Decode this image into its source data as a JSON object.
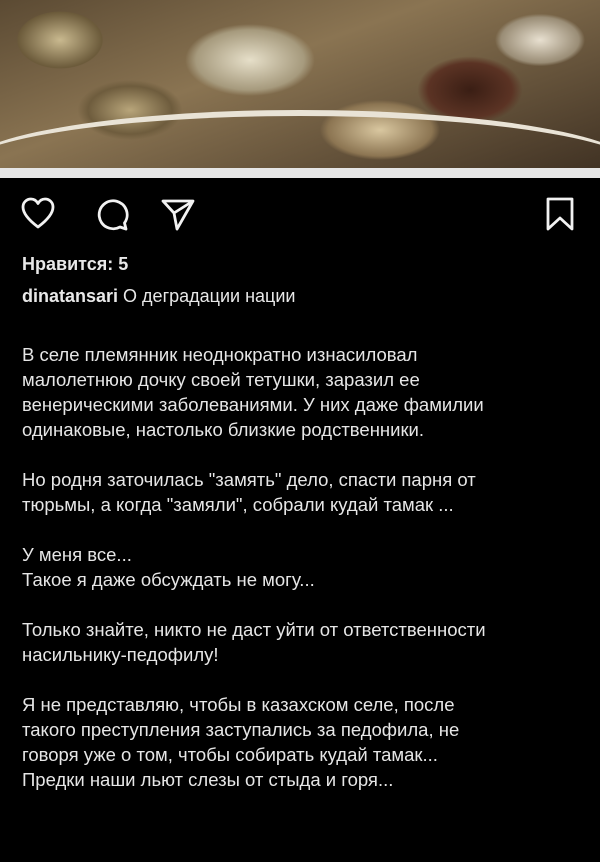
{
  "post": {
    "likes_text": "Нравится: 5",
    "username": "dinatansari",
    "caption": "О деградации нации",
    "paragraphs": [
      [
        "В селе племянник  неоднократно изнасиловал",
        "малолетнюю дочку своей тетушки, заразил ее",
        "венерическими заболеваниями. У них даже фамилии",
        "одинаковые, настолько близкие родственники."
      ],
      [
        "Но родня заточилась \"замять\" дело, спасти парня от",
        "тюрьмы, а когда \"замяли\", собрали кудай тамак ..."
      ],
      [
        "У меня все...",
        "Такое я даже обсуждать не могу..."
      ],
      [
        "Только знайте,  никто не даст уйти от ответственности",
        "насильнику-педофилу!"
      ],
      [
        "Я не представляю, чтобы в казахском селе, после",
        "такого преступления заступались за педофила, не",
        "говоря уже о том, чтобы собирать кудай тамак...",
        "Предки наши льют слезы от стыда и горя..."
      ]
    ]
  },
  "icons": {
    "like": "heart-icon",
    "comment": "comment-icon",
    "share": "send-icon",
    "save": "bookmark-icon"
  },
  "colors": {
    "background": "#000000",
    "text": "#e8e8e8"
  }
}
